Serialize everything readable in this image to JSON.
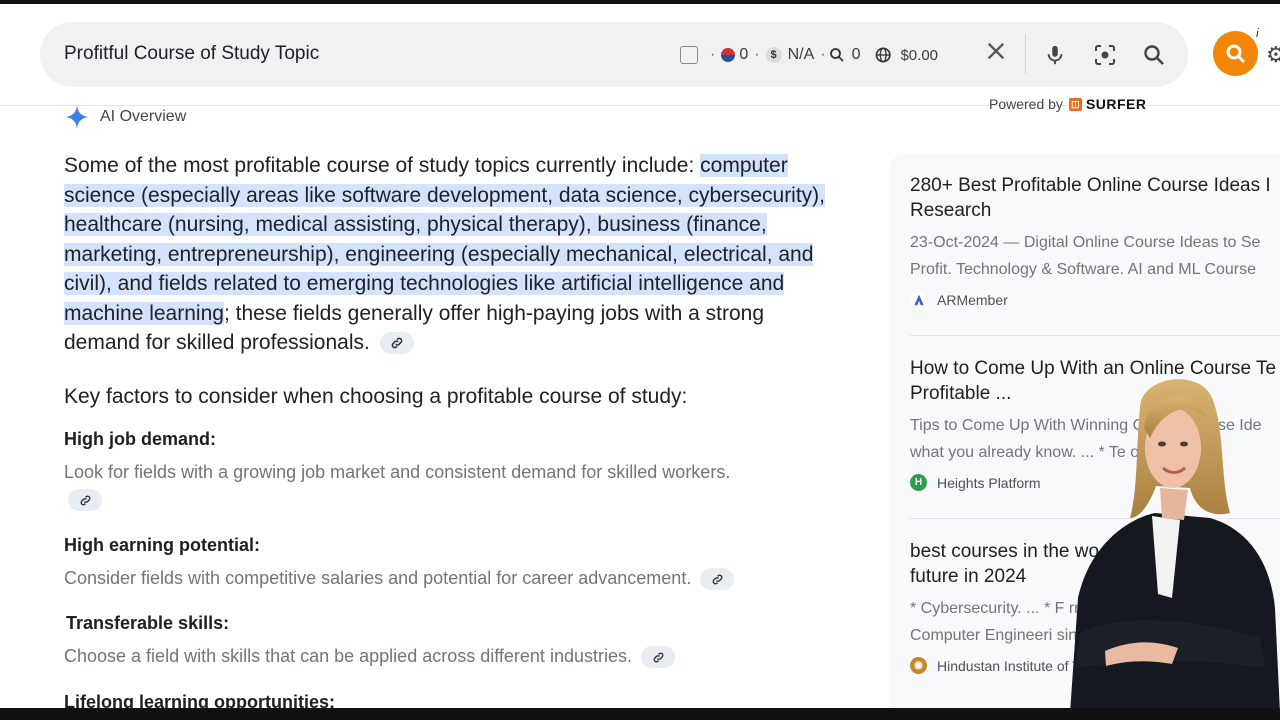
{
  "search": {
    "query": "Profitful Course of Study Topic",
    "stats": {
      "flag_count": "0",
      "dollar_value": "N/A",
      "search_count": "0",
      "globe_value": "$0.00"
    }
  },
  "powered_by": {
    "label": "Powered by",
    "brand": "SURFER"
  },
  "ai_overview": {
    "label": "AI Overview",
    "intro": "Some of the most profitable course of study topics currently include: ",
    "highlighted": "computer science (especially areas like software development, data science, cybersecurity), healthcare (nursing, medical assisting, physical therapy), business (finance, marketing, entrepreneurship), engineering (especially mechanical, electrical, and civil), and fields related to emerging technologies like artificial intelligence and machine learning",
    "outro": "; these fields generally offer high-paying jobs with a strong demand for skilled professionals.",
    "key_heading": "Key factors to consider when choosing a profitable course of study:",
    "factors": [
      {
        "title": "High job demand:",
        "desc": "Look for fields with a growing job market and consistent demand for skilled workers."
      },
      {
        "title": "High earning potential:",
        "desc": "Consider fields with competitive salaries and potential for career advancement."
      },
      {
        "title": "Transferable skills:",
        "desc": "Choose a field with skills that can be applied across different industries."
      },
      {
        "title": "Lifelong learning opportunities:",
        "desc": ""
      }
    ]
  },
  "sources": [
    {
      "title_line1": "280+ Best Profitable Online Course Ideas I",
      "title_line2": "Research",
      "snippet_line1": "23-Oct-2024 — Digital Online Course Ideas to Se",
      "snippet_line2": "Profit. Technology & Software. AI and ML Course",
      "site": "ARMember",
      "favicon_color": "#ffffff"
    },
    {
      "title_line1": "How to Come Up With an Online Course Te",
      "title_line2": "Profitable ...",
      "snippet_line1": "Tips to Come Up With Winning Online Course Ide",
      "snippet_line2": "what you already know. ... * Te              ou are p",
      "site": "Heights Platform",
      "favicon_color": "#2e9e4a",
      "favicon_letter": "H"
    },
    {
      "title_line1": "best courses in the wo",
      "title_line2": "future in 2024",
      "snippet_line1": "* Cybersecurity. ... * F                              rm",
      "snippet_line2": "Computer Engineeri                              sine",
      "site": "Hindustan Institute of Tec",
      "favicon_color": "#c8852a"
    }
  ],
  "colors": {
    "accent_orange": "#f28705",
    "highlight": "#d3e3fd"
  }
}
